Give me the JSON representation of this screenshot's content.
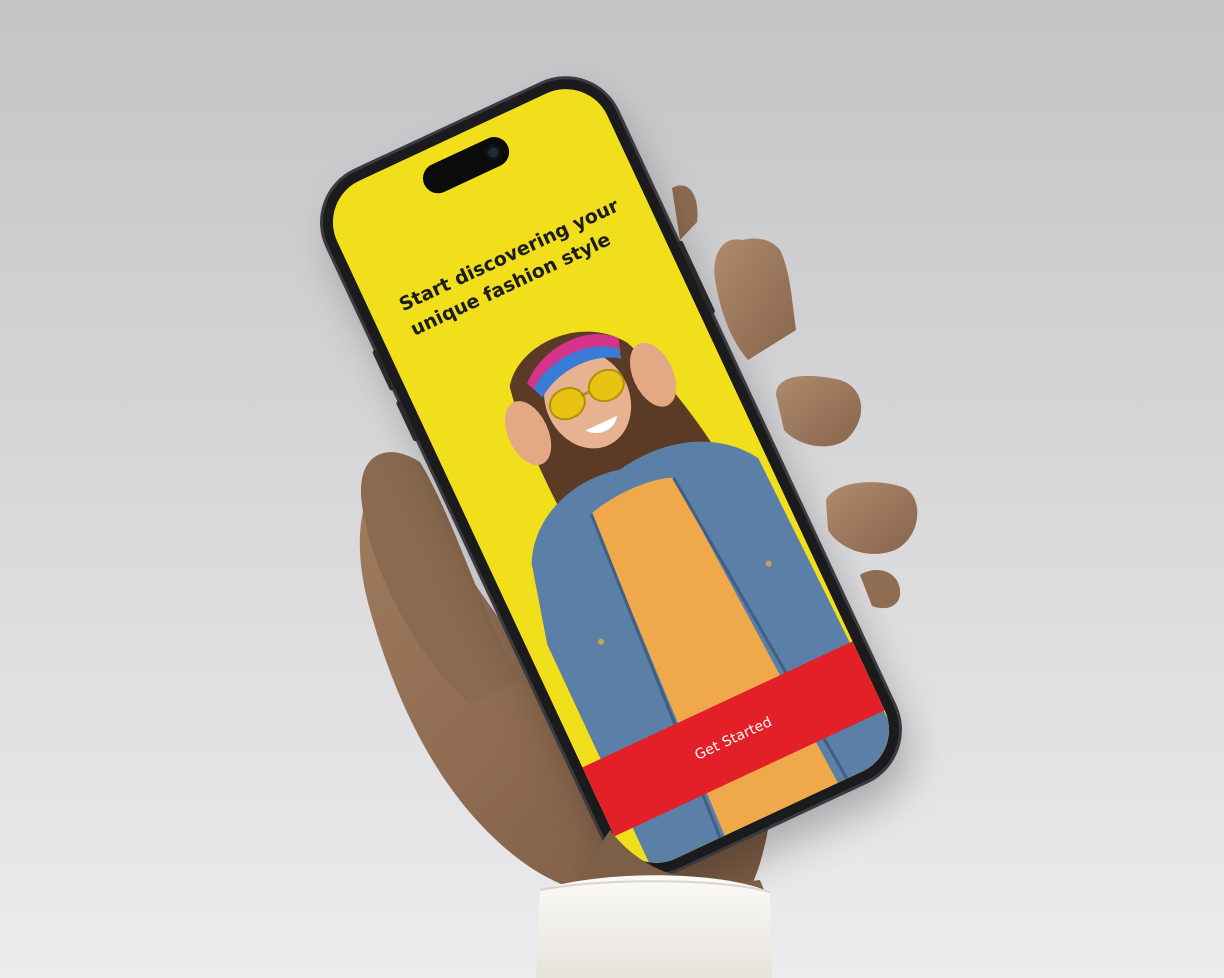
{
  "onboarding": {
    "headline": "Start discovering your unique fashion style",
    "cta_label": "Get Started"
  },
  "colors": {
    "screen_background": "#f2df1c",
    "cta_background": "#e32027",
    "cta_text": "#ffffff",
    "headline_text": "#1c1c1c"
  },
  "icons": [
    "front-camera-icon"
  ]
}
